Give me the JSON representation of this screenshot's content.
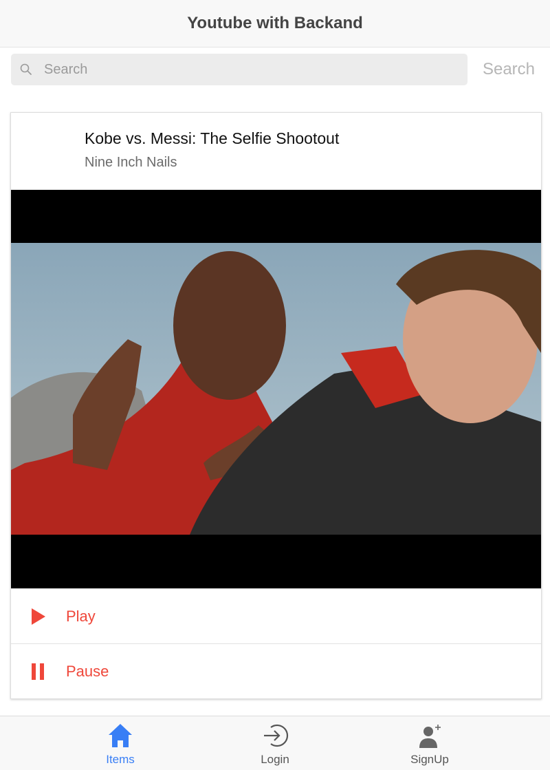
{
  "header": {
    "title": "Youtube with Backand"
  },
  "search": {
    "placeholder": "Search",
    "value": "",
    "button_label": "Search"
  },
  "video": {
    "title": "Kobe vs. Messi: The Selfie Shootout",
    "artist": "Nine Inch Nails",
    "thumbnail_icon": "video-thumbnail"
  },
  "actions": [
    {
      "label": "Play",
      "icon": "play-icon"
    },
    {
      "label": "Pause",
      "icon": "pause-icon"
    }
  ],
  "tabs": [
    {
      "label": "Items",
      "icon": "home-icon",
      "active": true
    },
    {
      "label": "Login",
      "icon": "login-icon",
      "active": false
    },
    {
      "label": "SignUp",
      "icon": "add-user-icon",
      "active": false
    }
  ],
  "colors": {
    "accent_red": "#ef473a",
    "active_tab_blue": "#387ef5",
    "header_bg": "#f8f8f8"
  }
}
